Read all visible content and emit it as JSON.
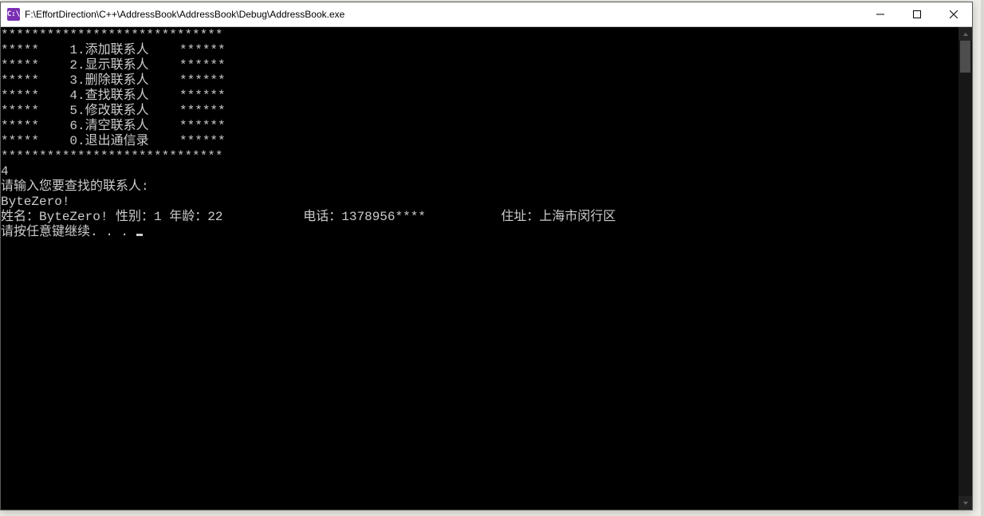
{
  "window": {
    "icon_text": "C:\\",
    "title": "F:\\EffortDirection\\C++\\AddressBook\\AddressBook\\Debug\\AddressBook.exe"
  },
  "menu": {
    "border_top": "*****************************",
    "lines": [
      "*****    1.添加联系人    ******",
      "*****    2.显示联系人    ******",
      "*****    3.删除联系人    ******",
      "*****    4.查找联系人    ******",
      "*****    5.修改联系人    ******",
      "*****    6.清空联系人    ******",
      "*****    0.退出通信录    ******"
    ],
    "border_bottom": "*****************************"
  },
  "io": {
    "choice": "4",
    "prompt": "请输入您要查找的联系人:",
    "input": "ByteZero!"
  },
  "result": {
    "name_label": "姓名：",
    "name": "ByteZero!",
    "sex_label": " 性别：",
    "sex": "1",
    "age_label": " 年龄：",
    "age": "22",
    "phone_label": "电话：",
    "phone": "1378956****",
    "addr_label": "住址：",
    "addr": "上海市闵行区"
  },
  "footer": {
    "press_any_key": "请按任意键继续. . . "
  }
}
